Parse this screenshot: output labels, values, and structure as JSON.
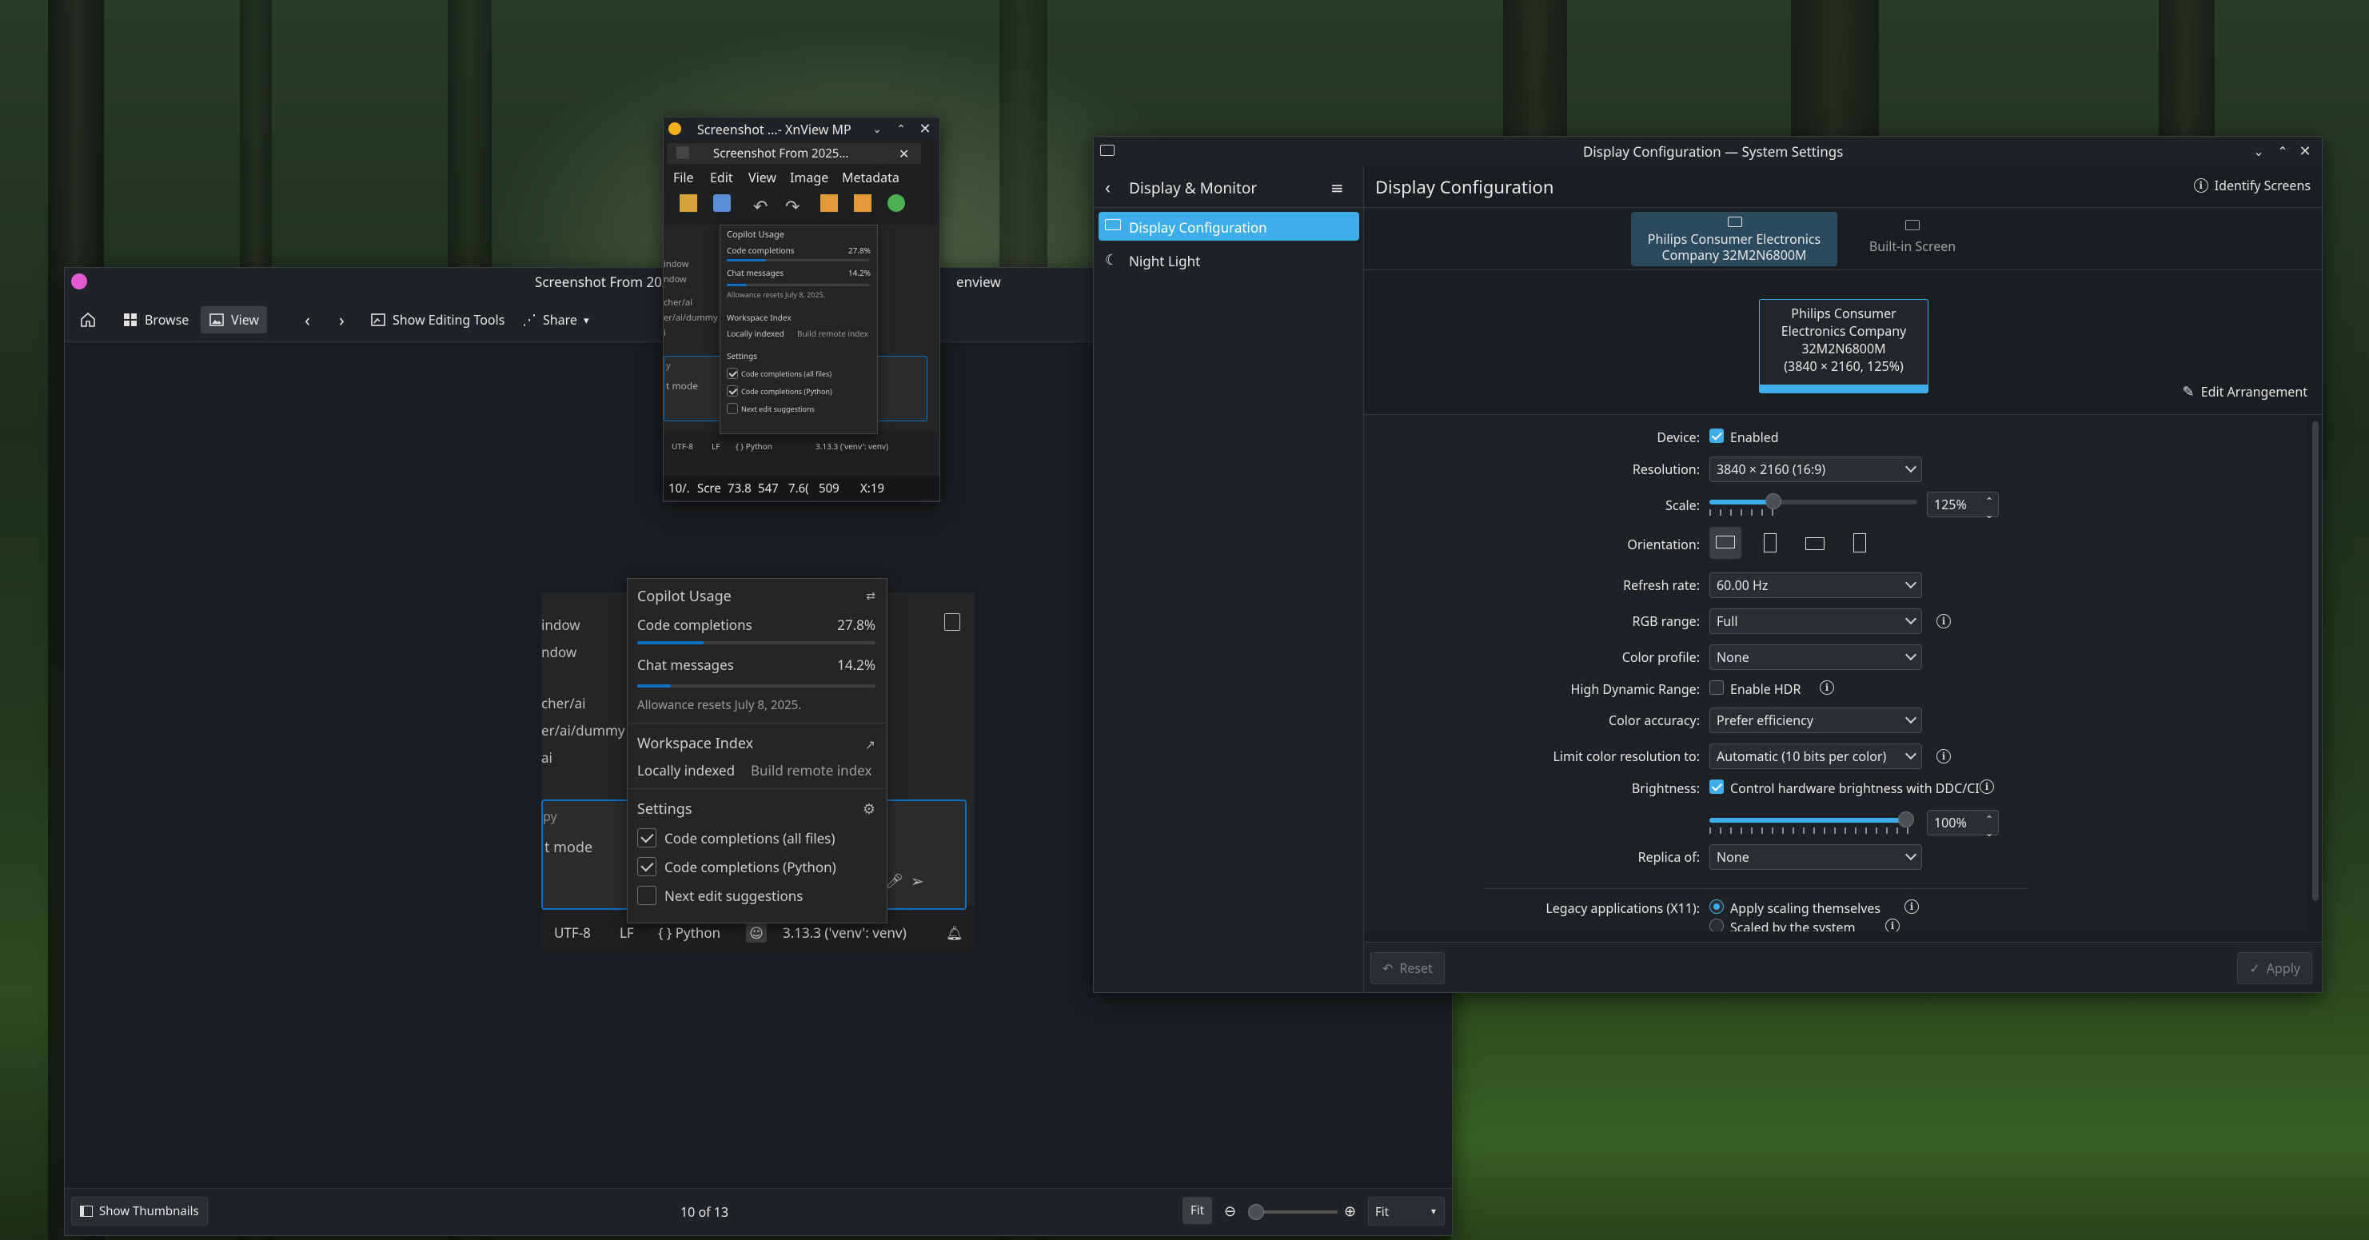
{
  "gwenview": {
    "title": "Screenshot From 202",
    "title_tail": "enview",
    "toolbar": {
      "browse": "Browse",
      "view": "View",
      "show_editing_tools": "Show Editing Tools",
      "share": "Share"
    },
    "status": {
      "show_thumbnails": "Show Thumbnails",
      "position": "10 of 13",
      "fit_button": "Fit",
      "zoom_select": "Fit"
    },
    "image": {
      "bg_lines": [
        "indow",
        "ndow",
        "cher/ai",
        "er/ai/dummy",
        "ai",
        "py",
        "t mode"
      ],
      "popup": {
        "title": "Copilot Usage",
        "code_label": "Code completions",
        "code_pct": "27.8%",
        "code_frac": 0.278,
        "chat_label": "Chat messages",
        "chat_pct": "14.2%",
        "chat_frac": 0.142,
        "allowance": "Allowance resets July 8, 2025.",
        "workspace_title": "Workspace Index",
        "locally": "Locally indexed",
        "build_remote": "Build remote index",
        "settings_title": "Settings",
        "opt1": "Code completions (all files)",
        "opt2": "Code completions (Python)",
        "opt3": "Next edit suggestions"
      },
      "statusbar": {
        "encoding": "UTF-8",
        "eol": "LF",
        "lang": "{ } Python",
        "interpreter": "3.13.3 ('venv': venv)"
      }
    }
  },
  "xnview": {
    "title": "Screenshot ...- XnView MP",
    "tab": "Screenshot From 2025...",
    "menu": [
      "File",
      "Edit",
      "View",
      "Image",
      "Metadata"
    ],
    "status_cells": [
      "10/.",
      "Scre",
      "73.8",
      "547",
      "7.6(",
      "509",
      "X:19"
    ],
    "side_lines": [
      "indow",
      "ndow",
      "cher/ai",
      "er/ai/dummy",
      "i",
      "y",
      "t mode"
    ],
    "mini_status": [
      "UTF-8",
      "LF",
      "{ } Python",
      "3.13.3 ('venv': venv)"
    ]
  },
  "settings": {
    "title": "Display Configuration — System Settings",
    "sidebar": {
      "back_title": "Display & Monitor",
      "items": [
        "Display Configuration",
        "Night Light"
      ]
    },
    "page_title": "Display Configuration",
    "identify": "Identify Screens",
    "tabs": [
      "Philips Consumer Electronics\nCompany 32M2N6800M",
      "Built-in Screen"
    ],
    "monitor_box": [
      "Philips Consumer",
      "Electronics Company",
      "32M2N6800M",
      "(3840 × 2160, 125%)"
    ],
    "edit_arrangement": "Edit Arrangement",
    "labels": {
      "device": "Device:",
      "resolution": "Resolution:",
      "scale": "Scale:",
      "orientation": "Orientation:",
      "refresh": "Refresh rate:",
      "rgb": "RGB range:",
      "color_profile": "Color profile:",
      "hdr": "High Dynamic Range:",
      "color_accuracy": "Color accuracy:",
      "limit_color": "Limit color resolution to:",
      "brightness": "Brightness:",
      "replica": "Replica of:",
      "legacy": "Legacy applications (X11):"
    },
    "values": {
      "enabled": "Enabled",
      "resolution": "3840 × 2160 (16:9)",
      "scale_pct": "125%",
      "scale_frac": 0.3,
      "refresh": "60.00 Hz",
      "rgb": "Full",
      "color_profile": "None",
      "hdr": "Enable HDR",
      "color_accuracy": "Prefer efficiency",
      "limit_color": "Automatic  (10 bits per color)",
      "brightness_ddc": "Control hardware brightness with DDC/CI",
      "brightness_pct": "100%",
      "brightness_frac": 1.0,
      "replica": "None",
      "legacy_opt1": "Apply scaling themselves",
      "legacy_opt2": "Scaled by the system"
    },
    "footer": {
      "reset": "Reset",
      "apply": "Apply"
    }
  }
}
